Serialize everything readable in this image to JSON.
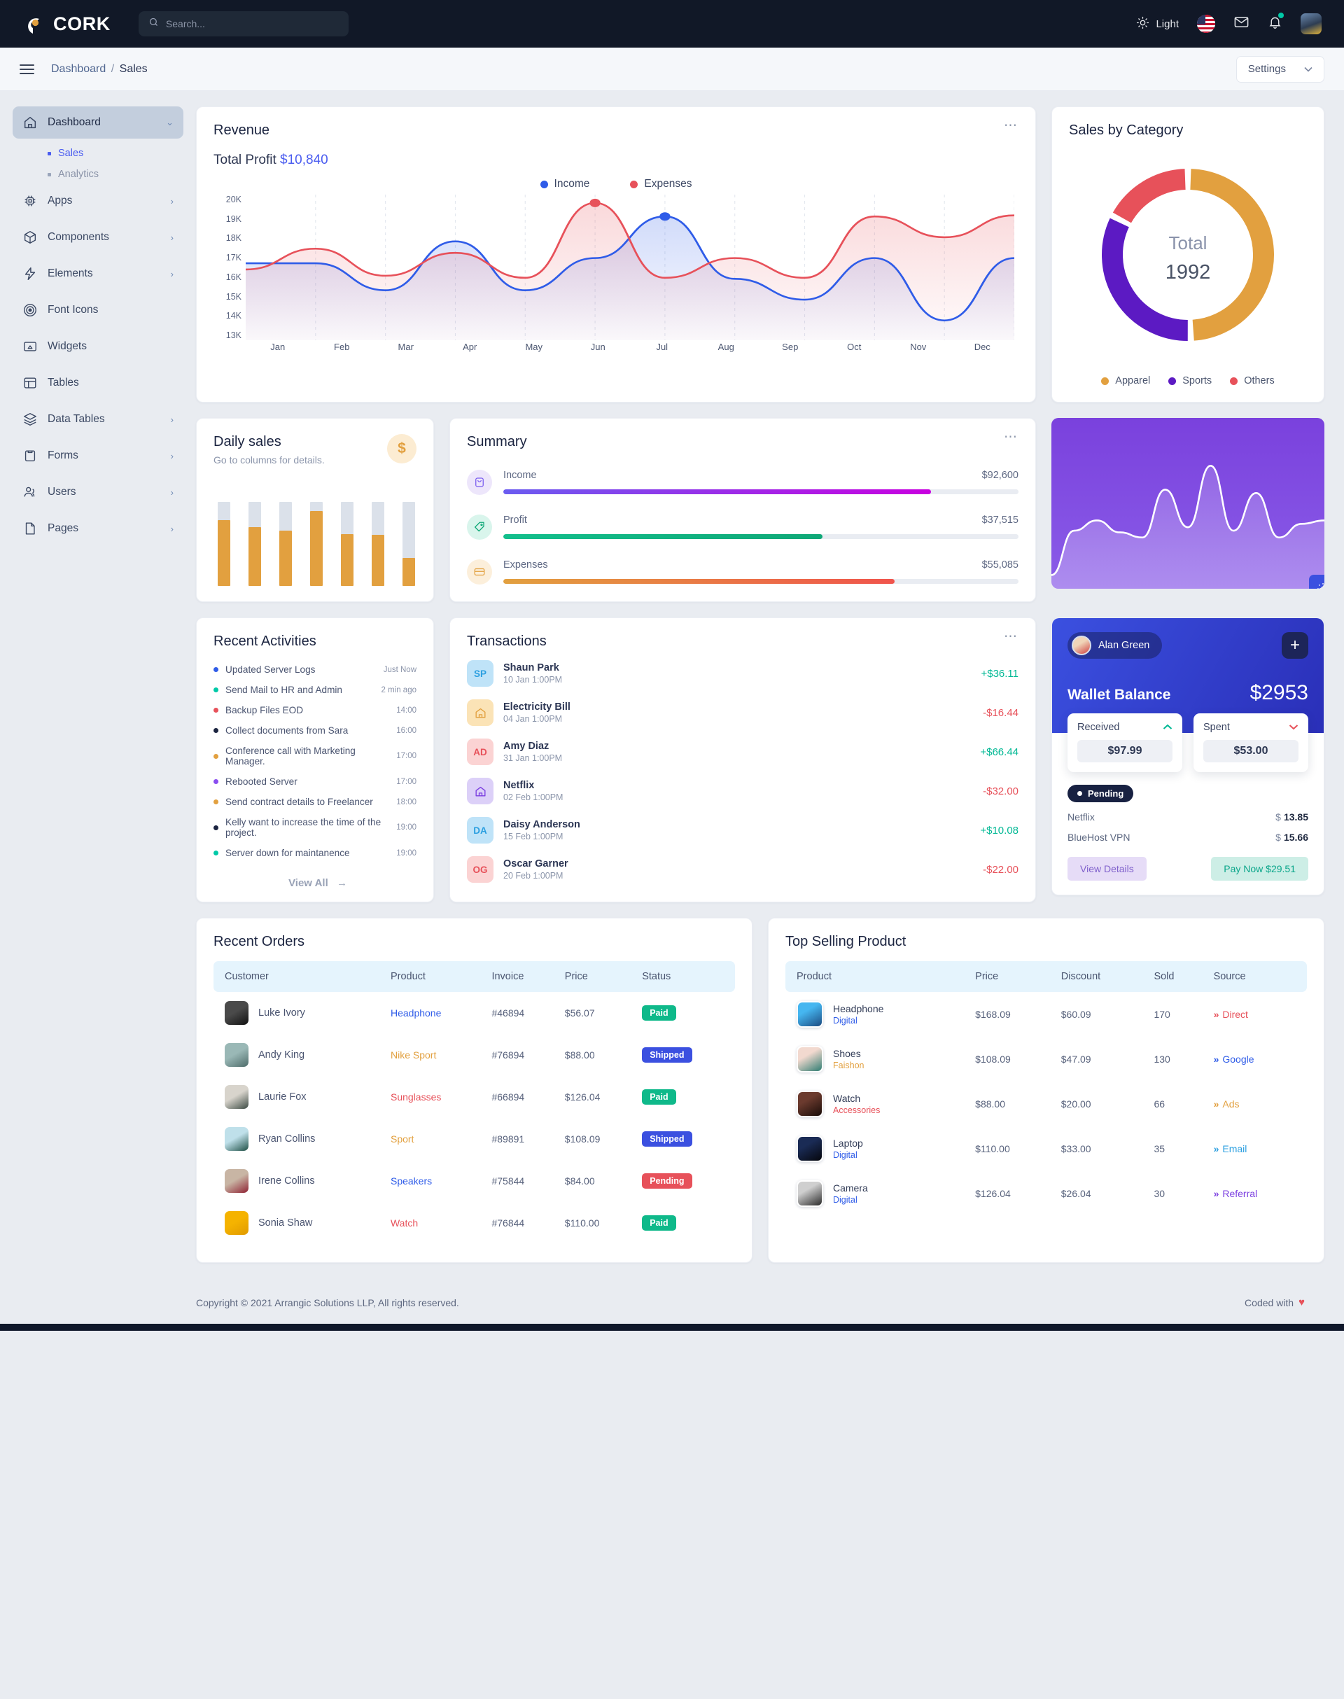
{
  "topbar": {
    "brand": "CORK",
    "search_placeholder": "Search...",
    "theme_label": "Light"
  },
  "crumbbar": {
    "root": "Dashboard",
    "sep": "/",
    "current": "Sales",
    "settings_label": "Settings"
  },
  "sidebar": {
    "items": [
      {
        "label": "Dashboard",
        "icon": "home-icon",
        "active": true,
        "chev": "⌄"
      },
      {
        "label": "Apps",
        "icon": "chip-icon",
        "chev": "›"
      },
      {
        "label": "Components",
        "icon": "box-icon",
        "chev": "›"
      },
      {
        "label": "Elements",
        "icon": "bolt-icon",
        "chev": "›"
      },
      {
        "label": "Font Icons",
        "icon": "target-icon",
        "chev": ""
      },
      {
        "label": "Widgets",
        "icon": "widget-icon",
        "chev": ""
      },
      {
        "label": "Tables",
        "icon": "table-icon",
        "chev": ""
      },
      {
        "label": "Data Tables",
        "icon": "layers-icon",
        "chev": "›"
      },
      {
        "label": "Forms",
        "icon": "clipboard-icon",
        "chev": "›"
      },
      {
        "label": "Users",
        "icon": "users-icon",
        "chev": "›"
      },
      {
        "label": "Pages",
        "icon": "page-icon",
        "chev": "›"
      }
    ],
    "sub": [
      {
        "label": "Sales",
        "selected": true
      },
      {
        "label": "Analytics",
        "selected": false
      }
    ]
  },
  "revenue": {
    "title": "Revenue",
    "profit_label": "Total Profit",
    "profit_value": "$10,840"
  },
  "bycat": {
    "title": "Sales by Category",
    "center_label": "Total",
    "center_value": "1992"
  },
  "dailysales": {
    "title": "Daily sales",
    "subtitle": "Go to columns for details.",
    "coin": "$"
  },
  "summary": {
    "title": "Summary",
    "rows": [
      {
        "label": "Income",
        "value": "$92,600",
        "pct": 83,
        "icon": "bag-icon",
        "from": "#6a5cf0",
        "to": "#c800e0",
        "bg": "#ede6fb",
        "stroke": "#7a5cf0"
      },
      {
        "label": "Profit",
        "value": "$37,515",
        "pct": 62,
        "icon": "tag-icon",
        "from": "#13bf8c",
        "to": "#0fa877",
        "bg": "#d9f5ec",
        "stroke": "#0fa877"
      },
      {
        "label": "Expenses",
        "value": "$55,085",
        "pct": 76,
        "icon": "card-icon",
        "from": "#e2a03f",
        "to": "#f0544c",
        "bg": "#fcefdb",
        "stroke": "#e2a03f"
      }
    ]
  },
  "activities": {
    "title": "Recent Activities",
    "view_all": "View All",
    "arrow": "→",
    "items": [
      {
        "text": "Updated Server Logs",
        "when": "Just Now",
        "color": "#2f5ce8"
      },
      {
        "text": "Send Mail to HR and Admin",
        "when": "2 min ago",
        "color": "#00c9a7"
      },
      {
        "text": "Backup Files EOD",
        "when": "14:00",
        "color": "#e7515a"
      },
      {
        "text": "Collect documents from Sara",
        "when": "16:00",
        "color": "#1b2440"
      },
      {
        "text": "Conference call with Marketing Manager.",
        "when": "17:00",
        "color": "#e2a03f"
      },
      {
        "text": "Rebooted Server",
        "when": "17:00",
        "color": "#8a4df0"
      },
      {
        "text": "Send contract details to Freelancer",
        "when": "18:00",
        "color": "#e2a03f"
      },
      {
        "text": "Kelly want to increase the time of the project.",
        "when": "19:00",
        "color": "#1b2440"
      },
      {
        "text": "Server down for maintanence",
        "when": "19:00",
        "color": "#00c9a7"
      }
    ]
  },
  "transactions": {
    "title": "Transactions",
    "items": [
      {
        "initials": "SP",
        "icon": "",
        "name": "Shaun Park",
        "date": "10 Jan 1:00PM",
        "amount": "+$36.11",
        "sign": "pos",
        "bg": "#bfe3f8",
        "fg": "#2b9fe0"
      },
      {
        "initials": "",
        "icon": "home-icon",
        "name": "Electricity Bill",
        "date": "04 Jan 1:00PM",
        "amount": "-$16.44",
        "sign": "neg",
        "bg": "#fbe3b6",
        "fg": "#e2a03f"
      },
      {
        "initials": "AD",
        "icon": "",
        "name": "Amy Diaz",
        "date": "31 Jan 1:00PM",
        "amount": "+$66.44",
        "sign": "pos",
        "bg": "#fbd3d3",
        "fg": "#e7515a"
      },
      {
        "initials": "",
        "icon": "home-icon",
        "name": "Netflix",
        "date": "02 Feb 1:00PM",
        "amount": "-$32.00",
        "sign": "neg",
        "bg": "#dcd0f8",
        "fg": "#7b3ee0"
      },
      {
        "initials": "DA",
        "icon": "",
        "name": "Daisy Anderson",
        "date": "15 Feb 1:00PM",
        "amount": "+$10.08",
        "sign": "pos",
        "bg": "#bfe3f8",
        "fg": "#2b9fe0"
      },
      {
        "initials": "OG",
        "icon": "",
        "name": "Oscar Garner",
        "date": "20 Feb 1:00PM",
        "amount": "-$22.00",
        "sign": "neg",
        "bg": "#fbd3d3",
        "fg": "#e7515a"
      }
    ]
  },
  "wallet": {
    "user": "Alan Green",
    "plus": "+",
    "balance_label": "Wallet Balance",
    "balance_value": "$2953",
    "received_label": "Received",
    "received_value": "$97.99",
    "spent_label": "Spent",
    "spent_value": "$53.00",
    "status": "Pending",
    "lines": [
      {
        "label": "Netflix",
        "cur": "$",
        "value": "13.85"
      },
      {
        "label": "BlueHost VPN",
        "cur": "$",
        "value": "15.66"
      }
    ],
    "view_details": "View Details",
    "pay_now": "Pay Now $29.51"
  },
  "recent_orders": {
    "title": "Recent Orders",
    "columns": [
      "Customer",
      "Product",
      "Invoice",
      "Price",
      "Status"
    ],
    "rows": [
      {
        "customer": "Luke Ivory",
        "product": "Headphone",
        "pcolor": "#2f5ce8",
        "invoice": "#46894",
        "price": "$56.07",
        "status": "Paid",
        "scolor": "#0fb98a",
        "av1": "#4a4a4a",
        "av2": "#111111"
      },
      {
        "customer": "Andy King",
        "product": "Nike Sport",
        "pcolor": "#e2a03f",
        "invoice": "#76894",
        "price": "$88.00",
        "status": "Shipped",
        "scolor": "#3b50e0",
        "av1": "#9ab8b6",
        "av2": "#4e6c6a"
      },
      {
        "customer": "Laurie Fox",
        "product": "Sunglasses",
        "pcolor": "#e7515a",
        "invoice": "#66894",
        "price": "$126.04",
        "status": "Paid",
        "scolor": "#0fb98a",
        "av1": "#d8d4cc",
        "av2": "#3c4a43"
      },
      {
        "customer": "Ryan Collins",
        "product": "Sport",
        "pcolor": "#e2a03f",
        "invoice": "#89891",
        "price": "$108.09",
        "status": "Shipped",
        "scolor": "#3b50e0",
        "av1": "#bfe0ea",
        "av2": "#1f4f45"
      },
      {
        "customer": "Irene Collins",
        "product": "Speakers",
        "pcolor": "#2f5ce8",
        "invoice": "#75844",
        "price": "$84.00",
        "status": "Pending",
        "scolor": "#e7515a",
        "av1": "#c8b5a4",
        "av2": "#8f2233"
      },
      {
        "customer": "Sonia Shaw",
        "product": "Watch",
        "pcolor": "#e7515a",
        "invoice": "#76844",
        "price": "$110.00",
        "status": "Paid",
        "scolor": "#0fb98a",
        "av1": "#f5b300",
        "av2": "#e09a00"
      }
    ]
  },
  "top_selling": {
    "title": "Top Selling Product",
    "columns": [
      "Product",
      "Price",
      "Discount",
      "Sold",
      "Source"
    ],
    "rows": [
      {
        "product": "Headphone",
        "cat": "Digital",
        "ccolor": "#2f5ce8",
        "price": "$168.09",
        "discount": "$60.09",
        "sold": "170",
        "source": "Direct",
        "srccolor": "#e7515a",
        "t1": "#45b6f0",
        "t2": "#1c4c82"
      },
      {
        "product": "Shoes",
        "cat": "Faishon",
        "ccolor": "#e2a03f",
        "price": "$108.09",
        "discount": "$47.09",
        "sold": "130",
        "source": "Google",
        "srccolor": "#2f5ce8",
        "t1": "#f2d9cf",
        "t2": "#2f7d72"
      },
      {
        "product": "Watch",
        "cat": "Accessories",
        "ccolor": "#e7515a",
        "price": "$88.00",
        "discount": "$20.00",
        "sold": "66",
        "source": "Ads",
        "srccolor": "#e2a03f",
        "t1": "#6b3a2e",
        "t2": "#190c08"
      },
      {
        "product": "Laptop",
        "cat": "Digital",
        "ccolor": "#2f5ce8",
        "price": "$110.00",
        "discount": "$33.00",
        "sold": "35",
        "source": "Email",
        "srccolor": "#2b9fe0",
        "t1": "#1a2b55",
        "t2": "#05060c"
      },
      {
        "product": "Camera",
        "cat": "Digital",
        "ccolor": "#2f5ce8",
        "price": "$126.04",
        "discount": "$26.04",
        "sold": "30",
        "source": "Referral",
        "srccolor": "#7b3ee0",
        "t1": "#cfcfcf",
        "t2": "#2a2a2a"
      }
    ],
    "source_chevron": "»"
  },
  "footer": {
    "copyright": "Copyright © 2021 Arrangic Solutions LLP, All rights reserved.",
    "coded_with": "Coded with",
    "heart": "♥"
  },
  "chart_data": [
    {
      "type": "area",
      "title": "Revenue",
      "xlabel": "",
      "ylabel": "",
      "ylim": [
        13000,
        20000
      ],
      "ytick_labels": [
        "20K",
        "19K",
        "18K",
        "17K",
        "16K",
        "15K",
        "14K",
        "13K"
      ],
      "categories": [
        "Jan",
        "Feb",
        "Mar",
        "Apr",
        "May",
        "Jun",
        "Jul",
        "Aug",
        "Sep",
        "Oct",
        "Nov",
        "Dec"
      ],
      "grid": true,
      "legend_position": "top-right",
      "series": [
        {
          "name": "Income",
          "color": "#2f5ce8",
          "values": [
            16700,
            16700,
            15400,
            17750,
            15400,
            16950,
            18950,
            15950,
            14950,
            16950,
            13950,
            16950
          ]
        },
        {
          "name": "Expenses",
          "color": "#e7515a",
          "values": [
            16400,
            17400,
            16100,
            17200,
            16000,
            19600,
            16000,
            16950,
            16000,
            18950,
            17950,
            19000
          ]
        }
      ],
      "markers": [
        {
          "series": "Expenses",
          "x": "Jun",
          "y": 19600
        },
        {
          "series": "Income",
          "x": "Jul",
          "y": 18950
        }
      ]
    },
    {
      "type": "pie",
      "title": "Sales by Category",
      "center_label": "Total",
      "center_value": 1992,
      "labels": [
        "Apparel",
        "Sports",
        "Others"
      ],
      "values": [
        985,
        660,
        347
      ],
      "percents": [
        49.5,
        33.1,
        17.4
      ],
      "colors": [
        "#e2a03f",
        "#5c1ac3",
        "#e7515a"
      ],
      "legend_position": "bottom"
    },
    {
      "type": "bar",
      "title": "Daily sales",
      "categories": [
        "1",
        "2",
        "3",
        "4",
        "5",
        "6",
        "7"
      ],
      "values": [
        78,
        70,
        66,
        89,
        62,
        61,
        33
      ],
      "track_max": 100,
      "color": "#e2a03f",
      "track_color": "#dbe1ea"
    },
    {
      "type": "area",
      "title": "",
      "color": "#ffffff",
      "background": "#7a41dd",
      "x": [
        0,
        1,
        2,
        3,
        4,
        5,
        6,
        7,
        8,
        9,
        10,
        11,
        12
      ],
      "values": [
        8,
        34,
        40,
        33,
        30,
        58,
        36,
        72,
        34,
        56,
        30,
        38,
        40
      ]
    }
  ]
}
